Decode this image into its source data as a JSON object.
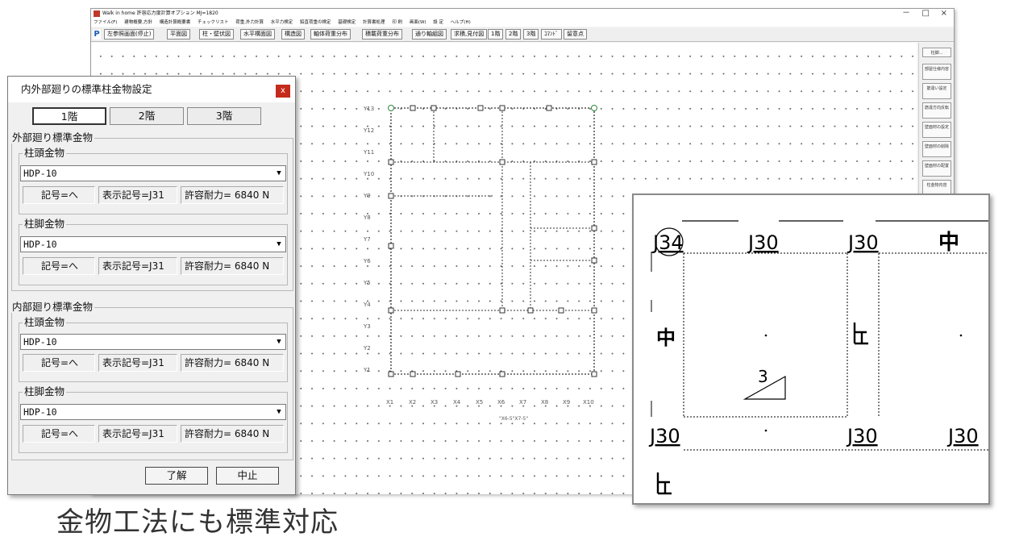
{
  "window": {
    "title": "Walk in home 許容応力度計算オプション MJ=1820",
    "controls": [
      "－",
      "□",
      "×"
    ]
  },
  "menubar": [
    "ファイル(F)",
    "建物概要,方針",
    "構造計算概要書",
    "チェックリスト",
    "荷重,外力計算",
    "水平力検定",
    "鉛直荷重の検定",
    "基礎検定",
    "計算書処理",
    "印 刷",
    "画面(W)",
    "設 定",
    "ヘルプ(H)"
  ],
  "toolbar": {
    "logo": "P",
    "buttons": [
      "左参照画面(停止)",
      "平面図",
      "柱・壁伏図",
      "水平構面図",
      "構造図",
      "軸体荷重分布",
      "積載荷重分布",
      "通り軸組図",
      "求積,見付図",
      "1階",
      "2階",
      "3階",
      "ｺﾏﾝﾄﾞ",
      "留意点"
    ]
  },
  "sidepanel": [
    "柱脚...",
    "部屋仕様内容",
    "筋違い設定",
    "筋違方向反転",
    "壁面材の設定",
    "壁面材の削除",
    "壁面材の配置",
    "柱金物内容"
  ],
  "axes": {
    "y": [
      "Y13",
      "Y12",
      "Y11",
      "Y10",
      "Y9",
      "Y8",
      "Y7",
      "Y6",
      "Y5",
      "Y4",
      "Y3",
      "Y2",
      "Y1"
    ],
    "x": [
      "X1",
      "X2",
      "X3",
      "X4",
      "X5",
      "X6",
      "X7",
      "X8",
      "X9",
      "X10"
    ],
    "spacing_note": "\"X6-5\"X7-5\""
  },
  "dialog": {
    "title": "内外部廻りの標準柱金物設定",
    "close": "x",
    "tabs": [
      "1階",
      "2階",
      "3階"
    ],
    "active_tab": 0,
    "outer_title": "外部廻り標準金物",
    "inner_title": "内部廻り標準金物",
    "head_label": "柱頭金物",
    "foot_label": "柱脚金物",
    "combo_value": "HDP-10",
    "symbol": "記号=へ",
    "display_symbol": "表示記号=J31",
    "capacity": "許容耐力= 6840 N",
    "ok": "了解",
    "cancel": "中止"
  },
  "zoom": {
    "labels_top": [
      "J34",
      "J30",
      "J30",
      "中"
    ],
    "labels_bottom": [
      "J30",
      "J30",
      "J30"
    ],
    "mid_left": "中",
    "brace_number": "3"
  },
  "caption": "金物工法にも標準対応"
}
